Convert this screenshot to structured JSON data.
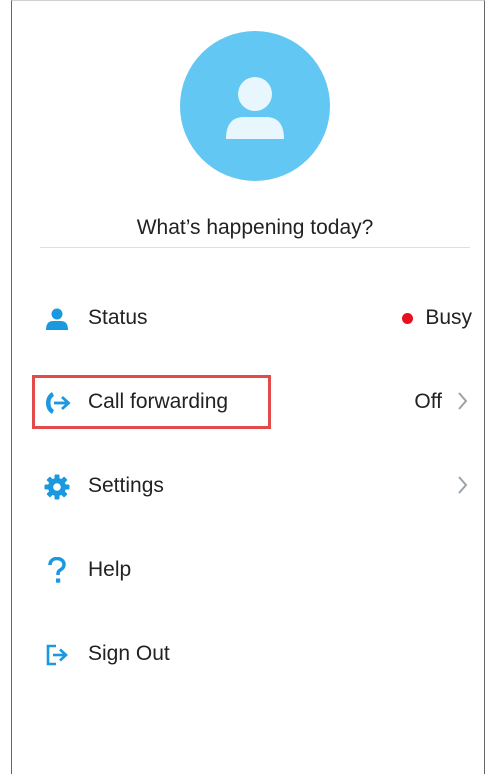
{
  "profile": {
    "avatar_icon": "person-icon",
    "mood_text": "What’s happening today?"
  },
  "menu": {
    "status": {
      "label": "Status",
      "value": "Busy",
      "icon": "person-icon",
      "status_color": "#e8101f"
    },
    "call_forwarding": {
      "label": "Call forwarding",
      "value": "Off",
      "icon": "call-forward-icon",
      "highlighted": true
    },
    "settings": {
      "label": "Settings",
      "icon": "gear-icon"
    },
    "help": {
      "label": "Help",
      "icon": "question-icon"
    },
    "sign_out": {
      "label": "Sign Out",
      "icon": "sign-out-icon"
    }
  },
  "colors": {
    "accent": "#1a98e0",
    "avatar_bg": "#62c7f2",
    "highlight_border": "#e34b4b",
    "busy": "#e8101f"
  }
}
